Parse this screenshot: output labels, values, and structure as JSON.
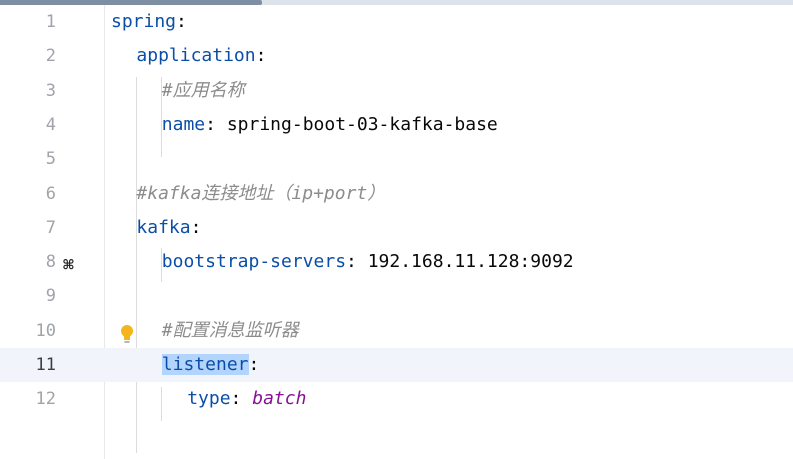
{
  "editor": {
    "current_line": 11,
    "lines": [
      {
        "num": "1",
        "key": "spring",
        "sep": ":",
        "comment": "",
        "value": "",
        "literal": ""
      },
      {
        "num": "2",
        "key": "application",
        "sep": ":",
        "comment": "",
        "value": "",
        "literal": ""
      },
      {
        "num": "3",
        "key": "",
        "sep": "",
        "comment": "#应用名称",
        "value": "",
        "literal": ""
      },
      {
        "num": "4",
        "key": "name",
        "sep": ":",
        "comment": "",
        "value": " spring-boot-03-kafka-base",
        "literal": ""
      },
      {
        "num": "5",
        "key": "",
        "sep": "",
        "comment": "",
        "value": "",
        "literal": ""
      },
      {
        "num": "6",
        "key": "",
        "sep": "",
        "comment": "#kafka连接地址（ip+port）",
        "value": "",
        "literal": ""
      },
      {
        "num": "7",
        "key": "kafka",
        "sep": ":",
        "comment": "",
        "value": "",
        "literal": ""
      },
      {
        "num": "8",
        "key": "bootstrap-servers",
        "sep": ":",
        "comment": "",
        "value": " 192.168.11.128:9092",
        "literal": ""
      },
      {
        "num": "9",
        "key": "",
        "sep": "",
        "comment": "",
        "value": "",
        "literal": ""
      },
      {
        "num": "10",
        "key": "",
        "sep": "",
        "comment": "#配置消息监听器",
        "value": "",
        "literal": ""
      },
      {
        "num": "11",
        "key": "listener",
        "sep": ":",
        "comment": "",
        "value": "",
        "literal": ""
      },
      {
        "num": "12",
        "key": "type",
        "sep": ":",
        "comment": "",
        "value": " ",
        "literal": "batch"
      }
    ]
  },
  "gutter_icons": {
    "line_8": "kafka-icon",
    "line_10": "intention-bulb-icon"
  },
  "colors": {
    "key": "#0b4ea8",
    "comment": "#8c8c8c",
    "literal": "#871094",
    "selection": "#b3d4fc",
    "current_line": "#f1f5fb",
    "bulb": "#f2b51c"
  }
}
